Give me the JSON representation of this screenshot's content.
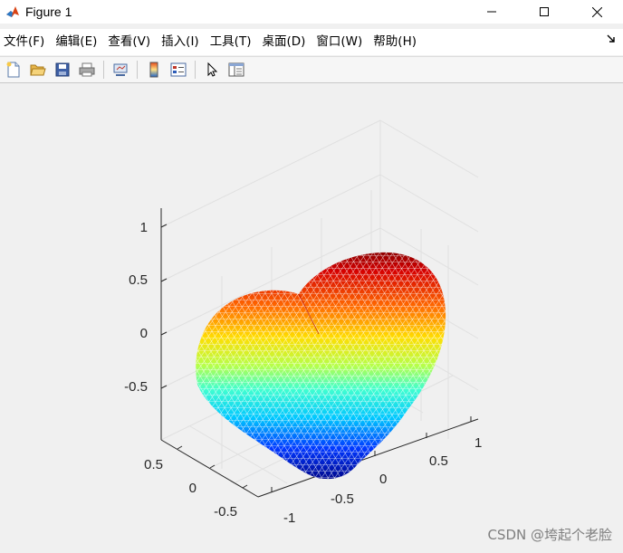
{
  "window": {
    "title": "Figure 1",
    "controls": [
      "minimize",
      "maximize",
      "close"
    ]
  },
  "menu": {
    "items": [
      {
        "label": "文件(F)"
      },
      {
        "label": "编辑(E)"
      },
      {
        "label": "查看(V)"
      },
      {
        "label": "插入(I)"
      },
      {
        "label": "工具(T)"
      },
      {
        "label": "桌面(D)"
      },
      {
        "label": "窗口(W)"
      },
      {
        "label": "帮助(H)"
      }
    ],
    "overflow_icon": "dock-arrow-icon"
  },
  "toolbar": {
    "buttons": [
      "new-figure-icon",
      "open-file-icon",
      "save-icon",
      "print-icon",
      "link-plot-icon",
      "colorbar-icon",
      "legend-icon",
      "pointer-icon",
      "property-inspector-icon"
    ]
  },
  "chart_data": {
    "type": "surface-mesh-3d",
    "title": "",
    "description": "3D heart-shaped triangulated mesh, jet colormap by z",
    "z_ticks": [
      "1",
      "0.5",
      "0",
      "-0.5"
    ],
    "y_ticks": [
      "0.5",
      "0",
      "-0.5"
    ],
    "x_ticks": [
      "1",
      "0.5",
      "0",
      "-0.5",
      "-1"
    ],
    "colormap": "jet",
    "grid": true,
    "box": false
  },
  "watermark": "CSDN @垮起个老脸"
}
